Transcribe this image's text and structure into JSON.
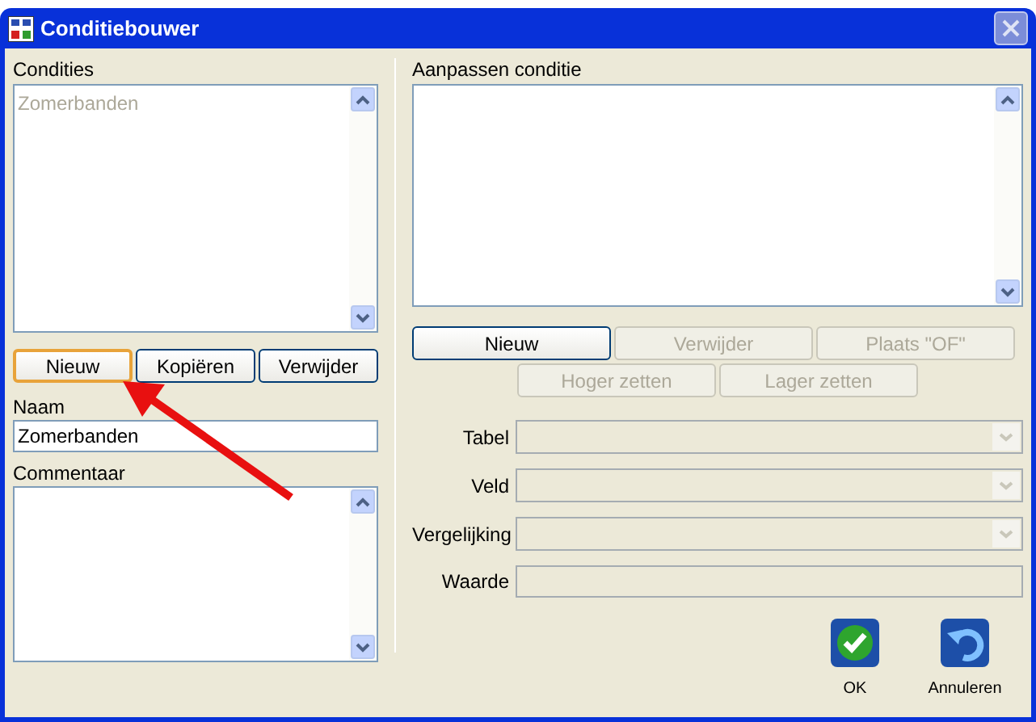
{
  "window": {
    "title": "Conditiebouwer"
  },
  "conditions": {
    "label": "Condities",
    "items": [
      "Zomerbanden"
    ],
    "buttons": [
      {
        "label": "Nieuw",
        "focused": true
      },
      {
        "label": "Kopiëren",
        "focused": false
      },
      {
        "label": "Verwijder",
        "focused": false
      }
    ]
  },
  "name": {
    "label": "Naam",
    "value": "Zomerbanden"
  },
  "comment": {
    "label": "Commentaar"
  },
  "edit": {
    "label": "Aanpassen conditie",
    "buttons": [
      {
        "label": "Nieuw",
        "disabled": false
      },
      {
        "label": "Verwijder",
        "disabled": true
      },
      {
        "label": "Plaats \"OF\"",
        "disabled": true
      }
    ],
    "buttons_row2": [
      {
        "label": "Hoger zetten",
        "disabled": true
      },
      {
        "label": "Lager zetten",
        "disabled": true
      }
    ],
    "fields": [
      {
        "label": "Tabel",
        "kind": "dropdown"
      },
      {
        "label": "Veld",
        "kind": "dropdown"
      },
      {
        "label": "Vergelijking",
        "kind": "dropdown"
      },
      {
        "label": "Waarde",
        "kind": "text"
      }
    ]
  },
  "actions": [
    {
      "label": "OK",
      "kind": "ok"
    },
    {
      "label": "Annuleren",
      "kind": "cancel"
    }
  ]
}
